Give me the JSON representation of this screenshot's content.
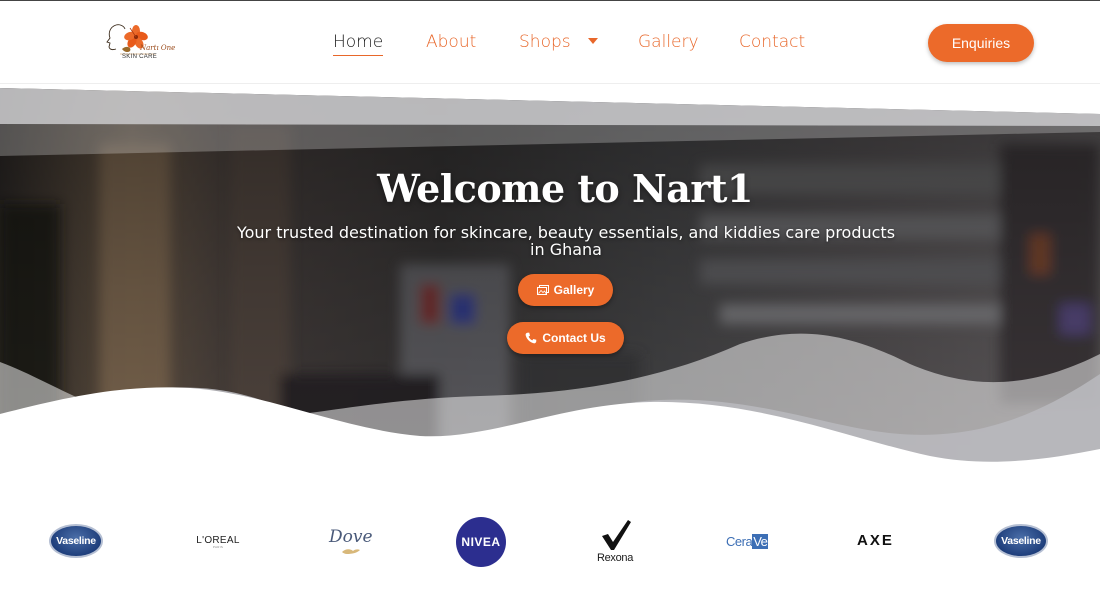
{
  "header": {
    "logo": {
      "script_text": "Nartı One",
      "sub_text": "SKIN CARE"
    },
    "nav": [
      {
        "id": "home",
        "label": "Home",
        "active": true
      },
      {
        "id": "about",
        "label": "About",
        "active": false
      },
      {
        "id": "shops",
        "label": "Shops",
        "active": false,
        "has_dropdown": true
      },
      {
        "id": "gallery",
        "label": "Gallery",
        "active": false
      },
      {
        "id": "contact",
        "label": "Contact",
        "active": false
      }
    ],
    "enquiries_label": "Enquiries"
  },
  "hero": {
    "title": "Welcome to Nart1",
    "subtitle": "Your trusted destination for skincare, beauty essentials, and kiddies care products in Ghana",
    "gallery_button": {
      "label": "Gallery",
      "icon": "images-icon"
    },
    "contact_button": {
      "label": "Contact Us",
      "icon": "phone-icon"
    }
  },
  "brands": [
    {
      "name": "Vaseline"
    },
    {
      "name": "L'OREAL",
      "tagline": "PARIS"
    },
    {
      "name": "Dove"
    },
    {
      "name": "NIVEA"
    },
    {
      "name": "Rexona"
    },
    {
      "name_main": "Cera",
      "name_box": "Ve"
    },
    {
      "name": "AXE"
    },
    {
      "name": "Vaseline"
    }
  ],
  "colors": {
    "accent": "#ec6a2a",
    "nav_text": "#e8672a",
    "nav_active": "#1a1a1a",
    "nivea_blue": "#2c2e8f",
    "vaseline_blue": "#1f3f7c"
  }
}
